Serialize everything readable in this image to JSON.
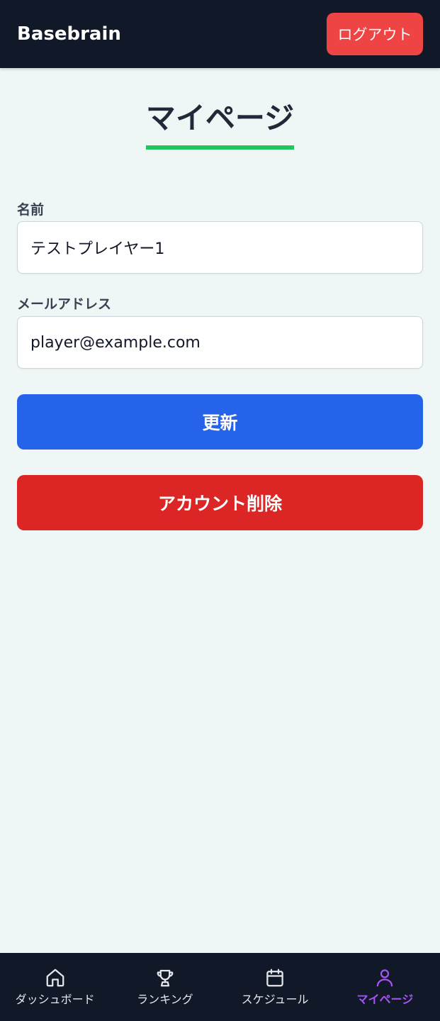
{
  "header": {
    "brand": "Basebrain",
    "logout_label": "ログアウト"
  },
  "page": {
    "title": "マイページ"
  },
  "form": {
    "name_label": "名前",
    "name_value": "テストプレイヤー1",
    "email_label": "メールアドレス",
    "email_value": "player@example.com",
    "update_label": "更新",
    "delete_label": "アカウント削除"
  },
  "nav": {
    "items": [
      {
        "label": "ダッシュボード",
        "icon": "home-icon"
      },
      {
        "label": "ランキング",
        "icon": "trophy-icon"
      },
      {
        "label": "スケジュール",
        "icon": "calendar-icon"
      },
      {
        "label": "マイページ",
        "icon": "user-icon",
        "active": true
      }
    ]
  },
  "colors": {
    "header_bg": "#111827",
    "logout_bg": "#ef4444",
    "title_underline": "#22c55e",
    "update_bg": "#2563eb",
    "delete_bg": "#dc2626",
    "active_nav": "#a855f7",
    "page_bg": "#eef7f5"
  }
}
